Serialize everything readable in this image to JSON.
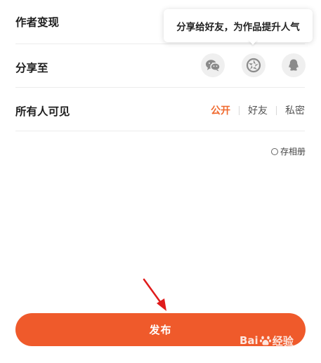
{
  "rows": {
    "monetize_label": "作者变现",
    "share_label": "分享至",
    "visibility_label": "所有人可见"
  },
  "tooltip": {
    "text": "分享给好友，为作品提升人气"
  },
  "share_targets": [
    {
      "name": "wechat",
      "icon": "wechat-icon"
    },
    {
      "name": "moments",
      "icon": "moments-icon"
    },
    {
      "name": "qq",
      "icon": "qq-icon"
    }
  ],
  "visibility": {
    "options": [
      "公开",
      "好友",
      "私密"
    ],
    "selected": "公开"
  },
  "save_album": {
    "label": "存相册",
    "checked": false
  },
  "publish": {
    "label": "发布"
  },
  "watermark": {
    "left": "Bai",
    "right": "经验"
  },
  "colors": {
    "accent": "#ef5a2b",
    "selected_text": "#f06a2f",
    "icon_bg": "#efefef"
  }
}
